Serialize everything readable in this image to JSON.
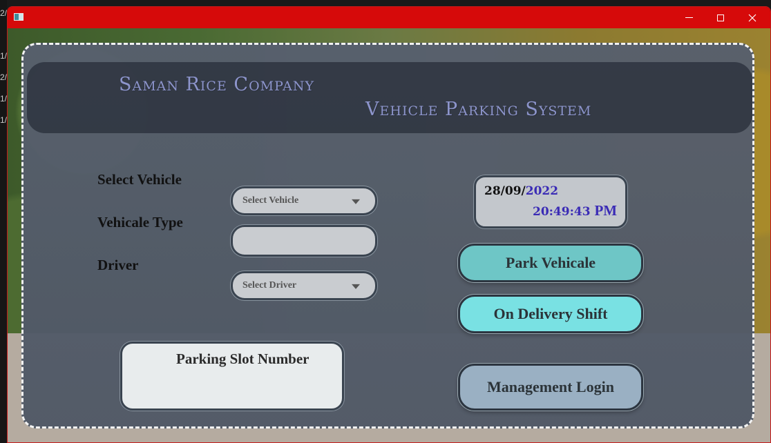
{
  "background_edge_text": [
    "2/",
    "1/",
    "2/",
    "1/",
    "1/"
  ],
  "window": {
    "title": "",
    "controls": {
      "minimize": "minimize",
      "maximize": "maximize",
      "close": "close"
    }
  },
  "header": {
    "company": "Saman Rice Company",
    "system": "Vehicle Parking System"
  },
  "form": {
    "select_vehicle": {
      "label": "Select Vehicle",
      "placeholder": "Select Vehicle"
    },
    "vehicle_type": {
      "label": "Vehicale Type",
      "value": ""
    },
    "driver": {
      "label": "Driver",
      "placeholder": "Select  Driver"
    }
  },
  "datetime": {
    "date_prefix": "28/09/",
    "year": "2022",
    "time": "20:49:43",
    "ampm": "PM"
  },
  "buttons": {
    "park": "Park Vehicale",
    "delivery": "On Delivery  Shift",
    "management": "Management Login"
  },
  "slot": {
    "title": "Parking Slot Number",
    "value": ""
  },
  "colors": {
    "titlebar": "#d60a0a",
    "header_text": "#8d95cc",
    "time_text": "#3a2bb5",
    "park_button": "#6ec6c6",
    "delivery_button": "#79e1e3",
    "management_button": "#9ab0c3"
  }
}
